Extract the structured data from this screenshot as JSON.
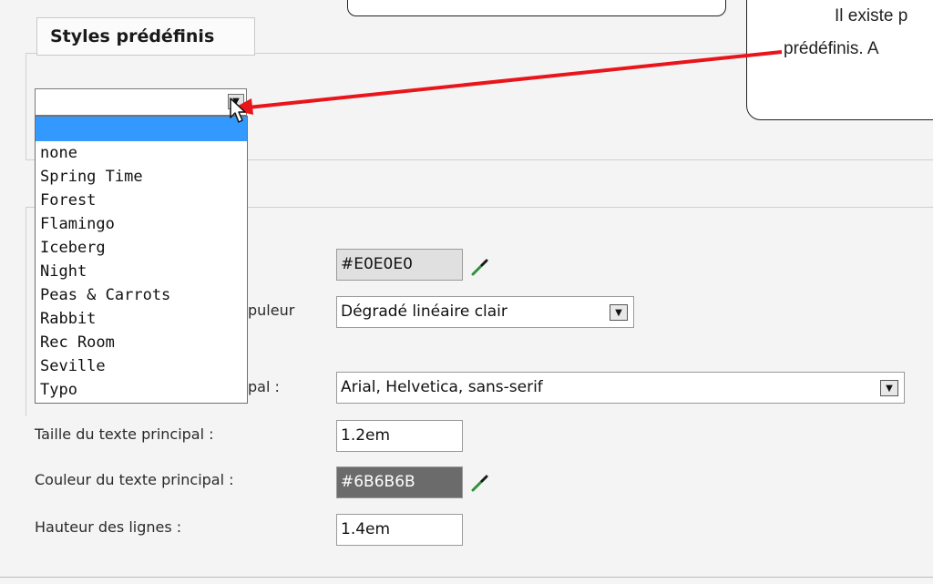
{
  "fieldset": {
    "legend": "Styles prédéfinis"
  },
  "callout": {
    "line1": "Il existe p",
    "line2": "prédéfinis. A"
  },
  "preset_select": {
    "value": "",
    "options": [
      "none",
      "Spring Time",
      "Forest",
      "Flamingo",
      "Iceberg",
      "Night",
      "Peas & Carrots",
      "Rabbit",
      "Rec Room",
      "Seville",
      "Typo"
    ]
  },
  "form": {
    "bg_color_value": "#E0E0E0",
    "gradient_label_partial": "puleur",
    "gradient_value": "Dégradé linéaire clair",
    "font_label_partial": "pal :",
    "font_value": "Arial, Helvetica, sans-serif",
    "size_label": "Taille du texte principal :",
    "size_value": "1.2em",
    "color_label": "Couleur du texte principal :",
    "color_value": "#6B6B6B",
    "line_height_label": "Hauteur des lignes :",
    "line_height_value": "1.4em"
  },
  "colors": {
    "arrow": "#e8151b",
    "highlight": "#3399ff",
    "bg_swatch": "#E0E0E0",
    "text_swatch": "#6B6B6B"
  },
  "icons": {
    "dropdown": "triangle-down-icon",
    "picker": "eyedropper-icon",
    "cursor": "mouse-pointer-icon"
  }
}
